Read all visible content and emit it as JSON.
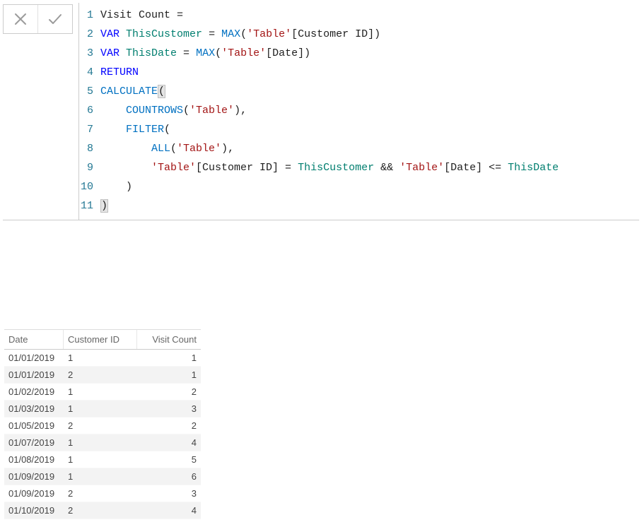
{
  "formulaBar": {
    "cancelIcon": "x",
    "commitIcon": "check"
  },
  "code": {
    "lines": [
      {
        "num": 1,
        "indent": 0,
        "tokens": [
          {
            "t": "plain",
            "v": "Visit Count ="
          }
        ]
      },
      {
        "num": 2,
        "indent": 0,
        "tokens": [
          {
            "t": "kw",
            "v": "VAR"
          },
          {
            "t": "plain",
            "v": " "
          },
          {
            "t": "var",
            "v": "ThisCustomer"
          },
          {
            "t": "plain",
            "v": " = "
          },
          {
            "t": "fn",
            "v": "MAX"
          },
          {
            "t": "plain",
            "v": "("
          },
          {
            "t": "str",
            "v": "'Table'"
          },
          {
            "t": "plain",
            "v": "[Customer ID])"
          }
        ]
      },
      {
        "num": 3,
        "indent": 0,
        "tokens": [
          {
            "t": "kw",
            "v": "VAR"
          },
          {
            "t": "plain",
            "v": " "
          },
          {
            "t": "var",
            "v": "ThisDate"
          },
          {
            "t": "plain",
            "v": " = "
          },
          {
            "t": "fn",
            "v": "MAX"
          },
          {
            "t": "plain",
            "v": "("
          },
          {
            "t": "str",
            "v": "'Table'"
          },
          {
            "t": "plain",
            "v": "[Date])"
          }
        ]
      },
      {
        "num": 4,
        "indent": 0,
        "tokens": [
          {
            "t": "kw",
            "v": "RETURN"
          }
        ]
      },
      {
        "num": 5,
        "indent": 0,
        "tokens": [
          {
            "t": "fn",
            "v": "CALCULATE"
          },
          {
            "t": "hl",
            "v": "("
          }
        ]
      },
      {
        "num": 6,
        "indent": 1,
        "tokens": [
          {
            "t": "fn",
            "v": "COUNTROWS"
          },
          {
            "t": "plain",
            "v": "("
          },
          {
            "t": "str",
            "v": "'Table'"
          },
          {
            "t": "plain",
            "v": "),"
          }
        ]
      },
      {
        "num": 7,
        "indent": 1,
        "tokens": [
          {
            "t": "fn",
            "v": "FILTER"
          },
          {
            "t": "plain",
            "v": "("
          }
        ]
      },
      {
        "num": 8,
        "indent": 2,
        "tokens": [
          {
            "t": "fn",
            "v": "ALL"
          },
          {
            "t": "plain",
            "v": "("
          },
          {
            "t": "str",
            "v": "'Table'"
          },
          {
            "t": "plain",
            "v": "),"
          }
        ]
      },
      {
        "num": 9,
        "indent": 2,
        "tokens": [
          {
            "t": "str",
            "v": "'Table'"
          },
          {
            "t": "plain",
            "v": "[Customer ID] = "
          },
          {
            "t": "var",
            "v": "ThisCustomer"
          },
          {
            "t": "plain",
            "v": " && "
          },
          {
            "t": "str",
            "v": "'Table'"
          },
          {
            "t": "plain",
            "v": "[Date] <= "
          },
          {
            "t": "var",
            "v": "ThisDate"
          }
        ]
      },
      {
        "num": 10,
        "indent": 1,
        "tokens": [
          {
            "t": "plain",
            "v": ")"
          }
        ]
      },
      {
        "num": 11,
        "indent": 0,
        "tokens": [
          {
            "t": "hl",
            "v": ")"
          }
        ]
      }
    ]
  },
  "table": {
    "headers": {
      "date": "Date",
      "customer": "Customer ID",
      "visit": "Visit Count"
    },
    "rows": [
      {
        "date": "01/01/2019",
        "customer": "1",
        "visit": "1"
      },
      {
        "date": "01/01/2019",
        "customer": "2",
        "visit": "1"
      },
      {
        "date": "01/02/2019",
        "customer": "1",
        "visit": "2"
      },
      {
        "date": "01/03/2019",
        "customer": "1",
        "visit": "3"
      },
      {
        "date": "01/05/2019",
        "customer": "2",
        "visit": "2"
      },
      {
        "date": "01/07/2019",
        "customer": "1",
        "visit": "4"
      },
      {
        "date": "01/08/2019",
        "customer": "1",
        "visit": "5"
      },
      {
        "date": "01/09/2019",
        "customer": "1",
        "visit": "6"
      },
      {
        "date": "01/09/2019",
        "customer": "2",
        "visit": "3"
      },
      {
        "date": "01/10/2019",
        "customer": "2",
        "visit": "4"
      }
    ]
  }
}
